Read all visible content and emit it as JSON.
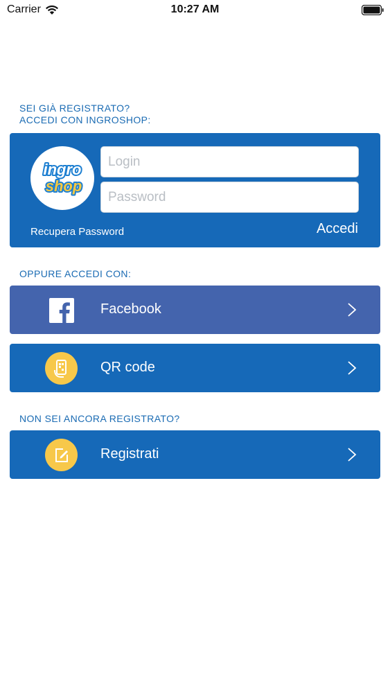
{
  "status_bar": {
    "carrier": "Carrier",
    "time": "10:27 AM"
  },
  "login_section": {
    "heading_line1": "SEI GIÀ REGISTRATO?",
    "heading_line2": "ACCEDI CON INGROSHOP:",
    "logo_text_top": "ingro",
    "logo_text_bottom": "shop",
    "login_placeholder": "Login",
    "password_placeholder": "Password",
    "recover_label": "Recupera Password",
    "submit_label": "Accedi"
  },
  "alt_login": {
    "heading": "OPPURE ACCEDI CON:",
    "facebook_label": "Facebook",
    "qr_label": "QR code"
  },
  "register_section": {
    "heading": "NON SEI ANCORA REGISTRATO?",
    "register_label": "Registrati"
  },
  "colors": {
    "primary_blue": "#1669b8",
    "facebook_blue": "#4464ad",
    "icon_yellow": "#f7c84a",
    "label_blue": "#1a6bb3"
  },
  "icons": {
    "wifi": "wifi-icon",
    "battery": "battery-icon",
    "facebook": "facebook-icon",
    "qr": "qr-phone-icon",
    "register": "edit-note-icon",
    "chevron": "chevron-right-icon"
  }
}
